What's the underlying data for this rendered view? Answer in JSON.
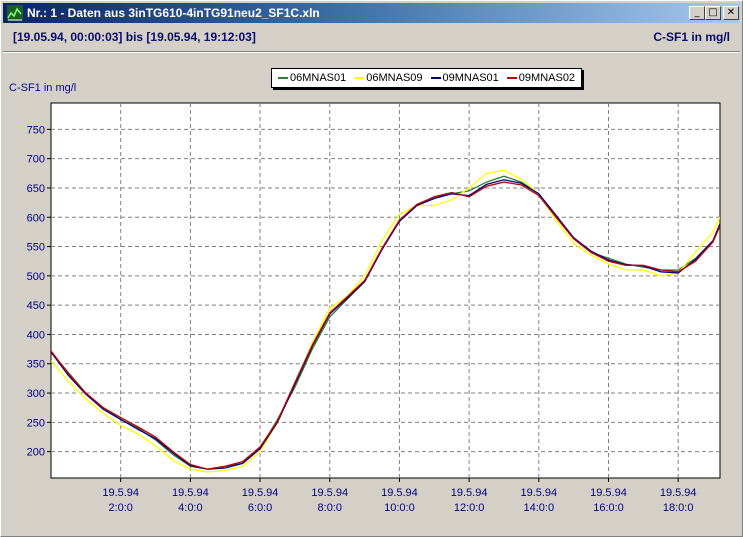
{
  "window": {
    "title": "Nr.: 1 - Daten aus 3inTG610-4inTG91neu2_SF1C.xln",
    "btn_min": "_",
    "btn_max": "□",
    "btn_close": "✕"
  },
  "info": {
    "range": "[19.05.94, 00:00:03] bis [19.05.94, 19:12:03]",
    "unit": "C-SF1 in mg/l"
  },
  "chart_data": {
    "type": "line",
    "ylabel": "C-SF1 in mg/l",
    "xlim": [
      0,
      19.2
    ],
    "ylim": [
      155,
      795
    ],
    "y_ticks": [
      200,
      250,
      300,
      350,
      400,
      450,
      500,
      550,
      600,
      650,
      700,
      750
    ],
    "x_ticks": [
      {
        "x": 2,
        "line1": "19.5.94",
        "line2": "2:0:0"
      },
      {
        "x": 4,
        "line1": "19.5.94",
        "line2": "4:0:0"
      },
      {
        "x": 6,
        "line1": "19.5.94",
        "line2": "6:0:0"
      },
      {
        "x": 8,
        "line1": "19.5.94",
        "line2": "8:0:0"
      },
      {
        "x": 10,
        "line1": "19.5.94",
        "line2": "10:0:0"
      },
      {
        "x": 12,
        "line1": "19.5.94",
        "line2": "12:0:0"
      },
      {
        "x": 14,
        "line1": "19.5.94",
        "line2": "14:0:0"
      },
      {
        "x": 16,
        "line1": "19.5.94",
        "line2": "16:0:0"
      },
      {
        "x": 18,
        "line1": "19.5.94",
        "line2": "18:0:0"
      }
    ],
    "grid": true,
    "legend_position": "top-center",
    "x": [
      0,
      0.5,
      1,
      1.5,
      2,
      2.5,
      3,
      3.5,
      4,
      4.5,
      5,
      5.5,
      6,
      6.5,
      7,
      7.5,
      8,
      8.5,
      9,
      9.5,
      10,
      10.5,
      11,
      11.5,
      12,
      12.5,
      13,
      13.5,
      14,
      14.5,
      15,
      15.5,
      16,
      16.5,
      17,
      17.5,
      18,
      18.5,
      19,
      19.2
    ],
    "series": [
      {
        "name": "06MNAS01",
        "color": "#2e7d32",
        "values": [
          370,
          335,
          300,
          275,
          255,
          240,
          220,
          195,
          175,
          170,
          175,
          180,
          205,
          255,
          310,
          375,
          430,
          460,
          490,
          545,
          595,
          620,
          635,
          640,
          645,
          660,
          670,
          660,
          640,
          600,
          565,
          540,
          530,
          520,
          515,
          510,
          510,
          530,
          560,
          590
        ]
      },
      {
        "name": "06MNAS09",
        "color": "#ffff00",
        "values": [
          355,
          320,
          290,
          265,
          245,
          230,
          210,
          185,
          170,
          165,
          168,
          175,
          200,
          250,
          315,
          385,
          445,
          465,
          500,
          560,
          605,
          620,
          620,
          630,
          650,
          675,
          680,
          665,
          640,
          595,
          555,
          535,
          520,
          510,
          510,
          500,
          505,
          540,
          575,
          600
        ]
      },
      {
        "name": "09MNAS01",
        "color": "#000080",
        "values": [
          370,
          330,
          298,
          272,
          255,
          238,
          222,
          198,
          176,
          170,
          172,
          180,
          205,
          250,
          315,
          380,
          435,
          462,
          490,
          545,
          593,
          620,
          632,
          640,
          637,
          656,
          664,
          658,
          640,
          603,
          565,
          542,
          527,
          519,
          517,
          507,
          505,
          528,
          560,
          588
        ]
      },
      {
        "name": "09MNAS02",
        "color": "#c00000",
        "values": [
          372,
          333,
          300,
          275,
          258,
          242,
          225,
          200,
          178,
          170,
          175,
          183,
          208,
          252,
          318,
          382,
          437,
          464,
          492,
          547,
          595,
          622,
          635,
          642,
          635,
          653,
          660,
          655,
          637,
          600,
          563,
          540,
          525,
          518,
          518,
          510,
          507,
          525,
          558,
          585
        ]
      }
    ]
  }
}
